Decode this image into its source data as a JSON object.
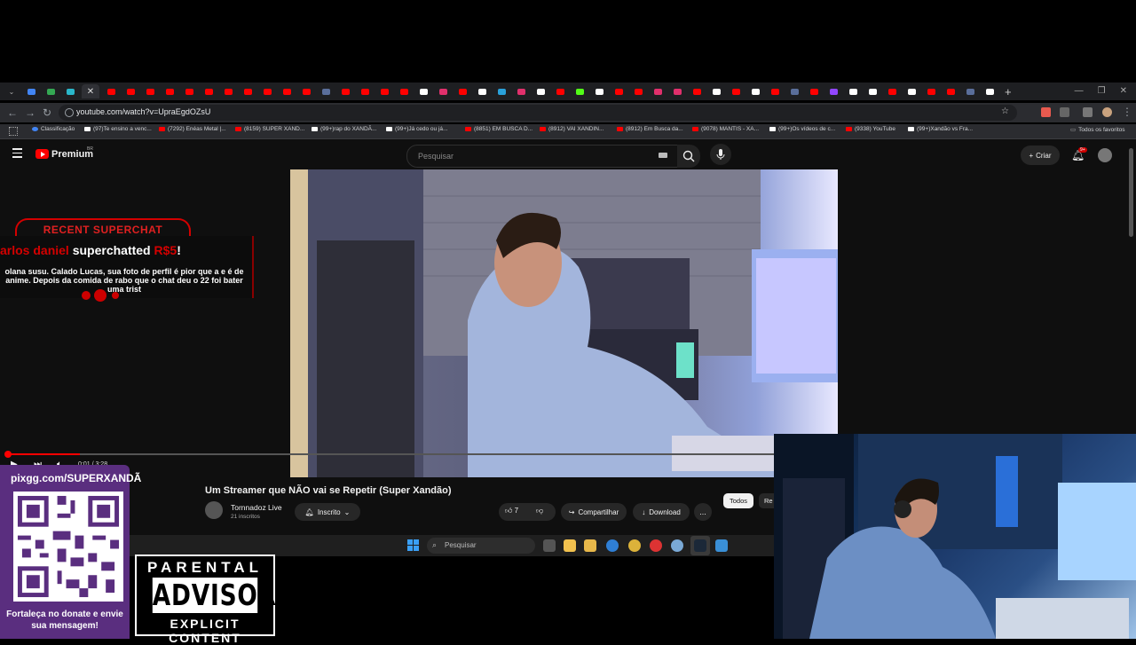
{
  "browser": {
    "tab_colors": [
      "#4285f4",
      "#34a853",
      "#2ab7ca",
      "#888888",
      "#ff0000",
      "#ff0000",
      "#ff0000",
      "#ff0000",
      "#ff0000",
      "#ff0000",
      "#ff0000",
      "#ff0000",
      "#ff0000",
      "#ff0000",
      "#ff0000",
      "#5a6e9a",
      "#ff0000",
      "#ff0000",
      "#ff0000",
      "#ff0000",
      "#ffffff",
      "#e1306c",
      "#ff0000",
      "#ffffff",
      "#2aa1da",
      "#e1306c",
      "#ffffff",
      "#ff0000",
      "#53fc18",
      "#ffffff",
      "#ff0000",
      "#ff0000",
      "#e1306c",
      "#e1306c",
      "#ff0000",
      "#ffffff",
      "#ff0000",
      "#ffffff",
      "#ff0000",
      "#5a6e9a",
      "#ff0000",
      "#9146ff",
      "#ffffff",
      "#ffffff",
      "#ff0000",
      "#ffffff",
      "#ff0000",
      "#ff0000",
      "#5a6e9a",
      "#ffffff"
    ],
    "address": "youtube.com/watch?v=UpraEgdOZsU",
    "bookmarks": [
      {
        "label": "Classificação",
        "icon": "chrome-icon"
      },
      {
        "label": "(97)Te ensino a venc...",
        "icon": "tiktok-icon"
      },
      {
        "label": "(7292) Enéas Metal |...",
        "icon": "youtube-icon"
      },
      {
        "label": "(8159) SUPER XAND...",
        "icon": "youtube-icon"
      },
      {
        "label": "(99+)rap do XANDÃ...",
        "icon": "tiktok-icon"
      },
      {
        "label": "(99+)Já cedo ou já...",
        "icon": "tiktok-icon"
      },
      {
        "label": "(8851) EM BUSCA D...",
        "icon": "youtube-icon"
      },
      {
        "label": "(8912) VAI XANDIN...",
        "icon": "youtube-icon"
      },
      {
        "label": "(8912) Em Busca da...",
        "icon": "youtube-icon"
      },
      {
        "label": "(9078) MANTIS - XA...",
        "icon": "youtube-icon"
      },
      {
        "label": "(99+)Os vídeos de c...",
        "icon": "tiktok-icon"
      },
      {
        "label": "(9338) YouTube",
        "icon": "youtube-icon"
      },
      {
        "label": "(99+)Xandão vs Fra...",
        "icon": "tiktok-icon"
      }
    ],
    "all_bookmarks": "Todos os favoritos"
  },
  "youtube": {
    "logo_text": "Premium",
    "country": "BR",
    "search_placeholder": "Pesquisar",
    "create_label": "Criar",
    "notifications": "9+",
    "player_time": "0:01 / 3:28",
    "progress_fraction": 0.095,
    "video_title": "Um Streamer que NÃO vai se Repetir (Super Xandão)",
    "channel_name": "Tornnadoz Live",
    "channel_subs": "21 inscritos",
    "subscribe_label": "Inscrito",
    "likes": "7",
    "share_label": "Compartilhar",
    "download_label": "Download",
    "more_label": "...",
    "chip_all": "Todos",
    "chip_next": "Re"
  },
  "superchat": {
    "badge": "RECENT SUPERCHAT",
    "user": "arlos daniel",
    "action": "superchatted",
    "amount": "R$5",
    "message": "olana susu. Calado Lucas, sua foto de perfil é pior que a e é de anime. Depois da comida de rabo que o chat deu o 22 foi bater uma trist"
  },
  "taskbar": {
    "search_label": "Pesquisar"
  },
  "qr_widget": {
    "url": "pixgg.com/SUPERXANDÃ",
    "footer": "Fortaleça no donate e envie sua mensagem!"
  },
  "advisory": {
    "top": "PARENTAL",
    "middle": "ADVISORY",
    "bottom": "EXPLICIT CONTENT"
  }
}
